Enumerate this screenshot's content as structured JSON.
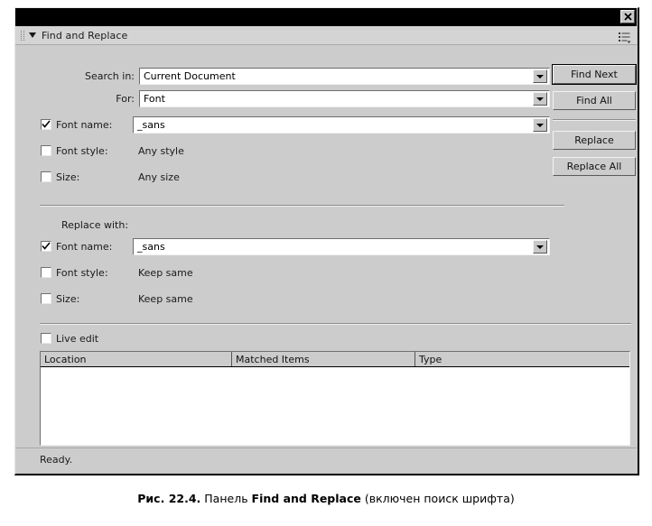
{
  "window": {
    "title": "",
    "close_icon": "close-x-icon"
  },
  "panel": {
    "title": "Find and Replace",
    "grip_icon": "drag-grip-icon",
    "collapse_icon": "triangle-down-icon",
    "options_icon": "panel-options-menu-icon"
  },
  "search_section": {
    "search_in": {
      "label": "Search in:",
      "value": "Current Document",
      "dropdown_icon": "chevron-down-icon"
    },
    "for": {
      "label": "For:",
      "value": "Font",
      "dropdown_icon": "chevron-down-icon"
    },
    "font_name": {
      "label": "Font name:",
      "value": "_sans",
      "checked": true,
      "dropdown_icon": "chevron-down-icon"
    },
    "font_style": {
      "label": "Font style:",
      "value": "Any style",
      "checked": false
    },
    "size": {
      "label": "Size:",
      "value": "Any size",
      "checked": false
    }
  },
  "replace_section": {
    "heading": "Replace with:",
    "font_name": {
      "label": "Font name:",
      "value": "_sans",
      "checked": true,
      "dropdown_icon": "chevron-down-icon"
    },
    "font_style": {
      "label": "Font style:",
      "value": "Keep same",
      "checked": false
    },
    "size": {
      "label": "Size:",
      "value": "Keep same",
      "checked": false
    }
  },
  "live_edit": {
    "label": "Live edit",
    "checked": false
  },
  "buttons": {
    "find_next": "Find Next",
    "find_all": "Find All",
    "replace": "Replace",
    "replace_all": "Replace All"
  },
  "results": {
    "columns": [
      "Location",
      "Matched Items",
      "Type"
    ],
    "rows": []
  },
  "status": {
    "text": "Ready."
  },
  "caption": {
    "figure_label": "Рис. 22.4.",
    "text_before": "Панель",
    "bold_term": "Find and Replace",
    "text_after": "(включен поиск шрифта)"
  },
  "colors": {
    "panel_bg": "#cccccc",
    "title_bar": "#000000",
    "field_bg": "#ffffff",
    "text": "#1a1a1a"
  }
}
